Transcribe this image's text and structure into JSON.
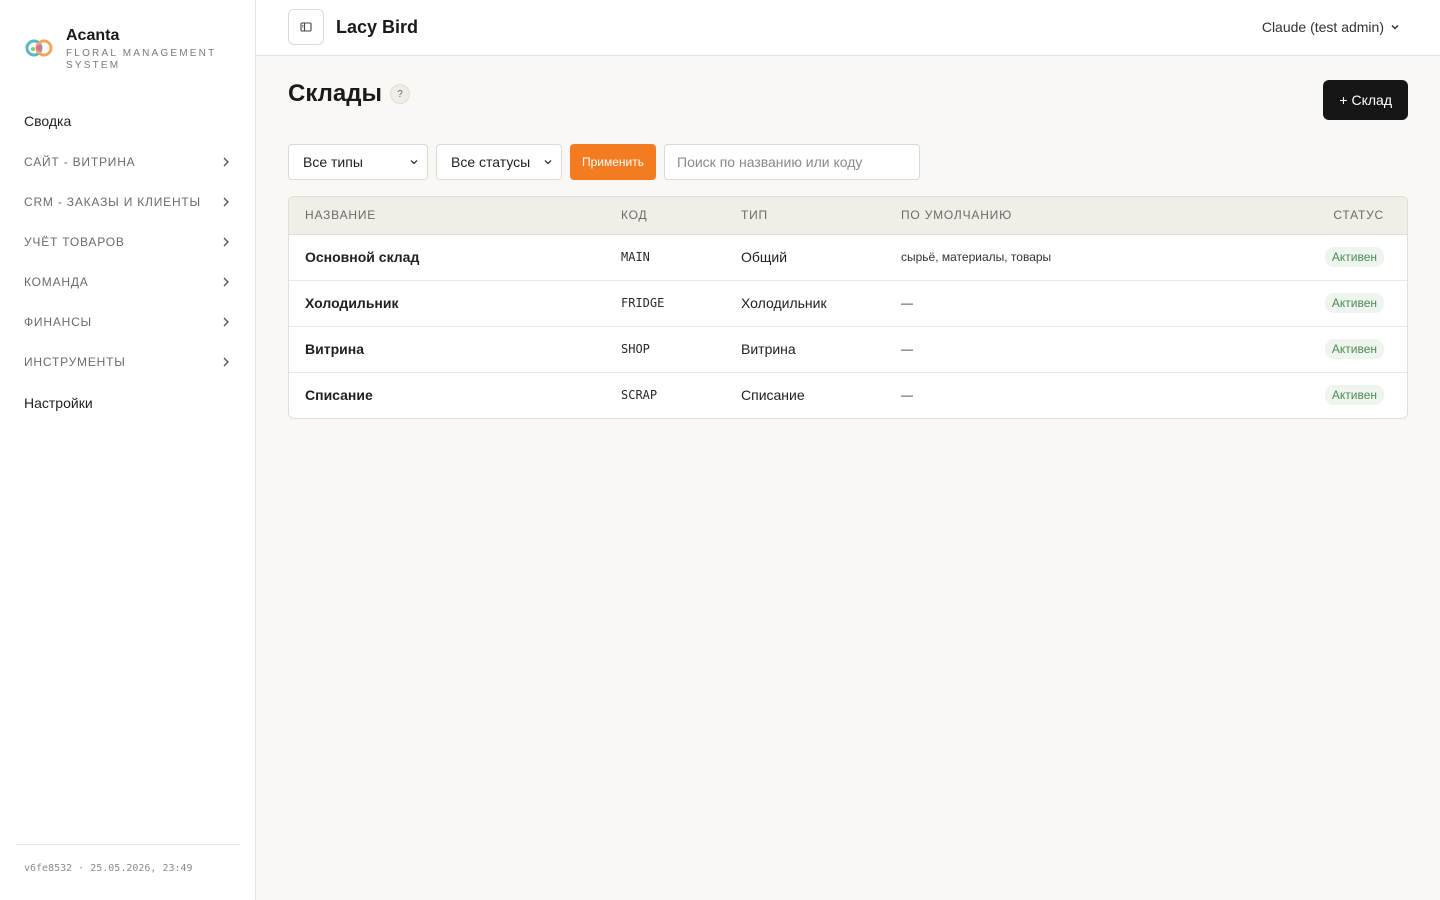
{
  "brand": {
    "name": "Acanta",
    "subtitle": "FLORAL MANAGEMENT SYSTEM"
  },
  "sidebar": {
    "items": [
      {
        "label": "Сводка",
        "kind": "plain"
      },
      {
        "label": "САЙТ - ВИТРИНА",
        "kind": "group"
      },
      {
        "label": "CRM - ЗАКАЗЫ И КЛИЕНТЫ",
        "kind": "group"
      },
      {
        "label": "УЧЁТ ТОВАРОВ",
        "kind": "group"
      },
      {
        "label": "КОМАНДА",
        "kind": "group"
      },
      {
        "label": "ФИНАНСЫ",
        "kind": "group"
      },
      {
        "label": "ИНСТРУМЕНТЫ",
        "kind": "group"
      },
      {
        "label": "Настройки",
        "kind": "plain"
      }
    ],
    "footer": "v6fe8532 · 25.05.2026, 23:49"
  },
  "header": {
    "org_name": "Lacy Bird",
    "user_label": "Claude (test admin)"
  },
  "page": {
    "title": "Склады",
    "help": "?",
    "add_button": "+ Склад"
  },
  "filters": {
    "type_value": "Все типы",
    "status_value": "Все статусы",
    "apply_label": "Применить",
    "search_placeholder": "Поиск по названию или коду"
  },
  "table": {
    "headers": [
      "НАЗВАНИЕ",
      "КОД",
      "ТИП",
      "ПО УМОЛЧАНИЮ",
      "СТАТУС"
    ],
    "rows": [
      {
        "name": "Основной склад",
        "code": "MAIN",
        "type": "Общий",
        "defaults": "сырьё, материалы, товары",
        "status": "Активен"
      },
      {
        "name": "Холодильник",
        "code": "FRIDGE",
        "type": "Холодильник",
        "defaults": "—",
        "status": "Активен"
      },
      {
        "name": "Витрина",
        "code": "SHOP",
        "type": "Витрина",
        "defaults": "—",
        "status": "Активен"
      },
      {
        "name": "Списание",
        "code": "SCRAP",
        "type": "Списание",
        "defaults": "—",
        "status": "Активен"
      }
    ]
  },
  "colors": {
    "accent": "#f47b20",
    "primary_button": "#161616",
    "status_active_bg": "#eef5ee",
    "status_active_text": "#4d8a53"
  },
  "icons": {
    "logo": "acanta-logo-icon",
    "sidebar_toggle": "sidebar-toggle-icon",
    "chevron": "chevron-right-icon",
    "user_dropdown": "chevron-down-icon"
  }
}
